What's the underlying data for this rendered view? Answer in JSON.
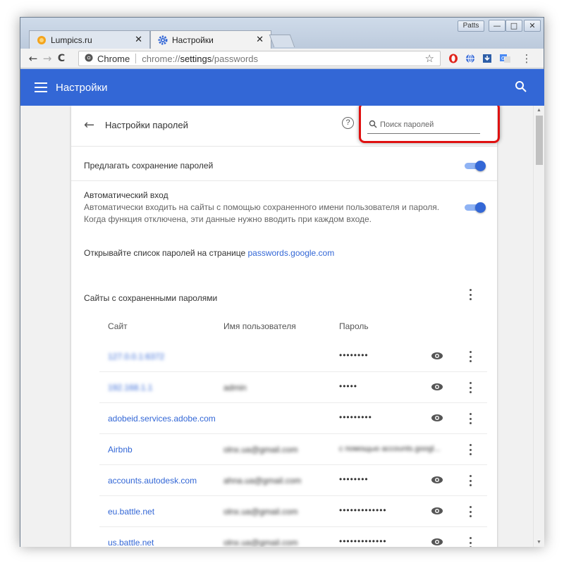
{
  "window": {
    "user_badge": "Patts",
    "buttons": {
      "minimize": "—",
      "maximize": "□",
      "close": "✕"
    }
  },
  "tabs": [
    {
      "label": "Lumpics.ru",
      "close": "✕"
    },
    {
      "label": "Настройки",
      "close": "✕"
    }
  ],
  "toolbar": {
    "back": "←",
    "forward": "→",
    "reload": "C",
    "chrome_label": "Chrome",
    "url_prefix": "chrome://",
    "url_host": "settings",
    "url_path": "/passwords",
    "star": "☆",
    "menu": "⋮"
  },
  "appbar": {
    "title": "Настройки"
  },
  "header": {
    "back": "←",
    "title": "Настройки паролей",
    "help": "?",
    "search_placeholder": "Поиск паролей"
  },
  "settings": {
    "offer_save": {
      "label": "Предлагать сохранение паролей",
      "enabled": true
    },
    "auto_signin": {
      "label": "Автоматический вход",
      "desc_line1": "Автоматически входить на сайты с помощью сохраненного имени пользователя и пароля.",
      "desc_line2": "Когда функция отключена, эти данные нужно вводить при каждом входе.",
      "enabled": true
    },
    "google_link": {
      "prefix": "Открывайте список паролей на странице ",
      "link": "passwords.google.com"
    }
  },
  "saved": {
    "title": "Сайты с сохраненными паролями",
    "columns": {
      "site": "Сайт",
      "user": "Имя пользователя",
      "password": "Пароль"
    },
    "rows": [
      {
        "site": "127.0.0.1:6372",
        "user": "",
        "password": "••••••••",
        "blurred_site": true,
        "blurred_user": false,
        "eye": true
      },
      {
        "site": "192.168.1.1",
        "user": "admin",
        "password": "•••••",
        "blurred_site": true,
        "blurred_user": true,
        "eye": true
      },
      {
        "site": "adobeid.services.adobe.com",
        "user": "",
        "password": "•••••••••",
        "blurred_site": false,
        "blurred_user": false,
        "eye": true
      },
      {
        "site": "Airbnb",
        "user": "olnx.ua@gmail.com",
        "password": "с помощью accounts.googl...",
        "blurred_site": false,
        "blurred_user": true,
        "eye": false
      },
      {
        "site": "accounts.autodesk.com",
        "user": "ahna.ua@gmail.com",
        "password": "••••••••",
        "blurred_site": false,
        "blurred_user": true,
        "eye": true
      },
      {
        "site": "eu.battle.net",
        "user": "olnx.ua@gmail.com",
        "password": "•••••••••••••",
        "blurred_site": false,
        "blurred_user": true,
        "eye": true
      },
      {
        "site": "us.battle.net",
        "user": "olnx.ua@gmail.com",
        "password": "•••••••••••••",
        "blurred_site": false,
        "blurred_user": true,
        "eye": true
      }
    ]
  },
  "colors": {
    "accent": "#3367d6",
    "highlight": "#e01010",
    "toggle_track": "#8fb3f4"
  }
}
